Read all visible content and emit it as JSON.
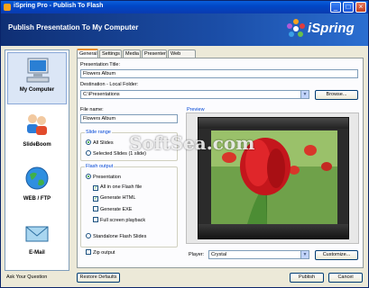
{
  "window": {
    "title": "iSpring Pro - Publish To Flash"
  },
  "banner": {
    "heading": "Publish Presentation To My Computer",
    "logo": "iSpring"
  },
  "nav": [
    {
      "label": "My Computer",
      "icon": "computer-icon"
    },
    {
      "label": "SlideBoom",
      "icon": "users-icon"
    },
    {
      "label": "WEB / FTP",
      "icon": "globe-icon"
    },
    {
      "label": "E-Mail",
      "icon": "mail-icon"
    }
  ],
  "tabs": [
    "General",
    "Settings",
    "Media",
    "Presenter",
    "Web Links"
  ],
  "form": {
    "presentation_title_label": "Presentation Title:",
    "presentation_title": "Flowers Album",
    "destination_label": "Destination - Local Folder:",
    "destination": "C:\\Presentations",
    "browse": "Browse...",
    "file_name_label": "File name:",
    "file_name": "Flowers Album"
  },
  "slide_range": {
    "title": "Slide range",
    "all": "All Slides",
    "selected": "Selected Slides (1 slide)"
  },
  "flash_output": {
    "title": "Flash output",
    "presentation": "Presentation",
    "all_in_one": "All in one Flash file",
    "generate_html": "Generate HTML",
    "generate_exe": "Generate EXE",
    "full_screen": "Full screen playback",
    "standalone": "Standalone Flash Slides",
    "zip": "Zip output"
  },
  "preview": {
    "title": "Preview",
    "player_label": "Player:",
    "player_value": "Crystal",
    "customize": "Customize...",
    "watermark": "SoftSea.com"
  },
  "footer": {
    "ask": "Ask Your Question",
    "restore": "Restore Defaults",
    "publish": "Publish",
    "cancel": "Cancel"
  },
  "titlebar_buttons": {
    "minimize": "_",
    "maximize": "□",
    "close": "×"
  }
}
